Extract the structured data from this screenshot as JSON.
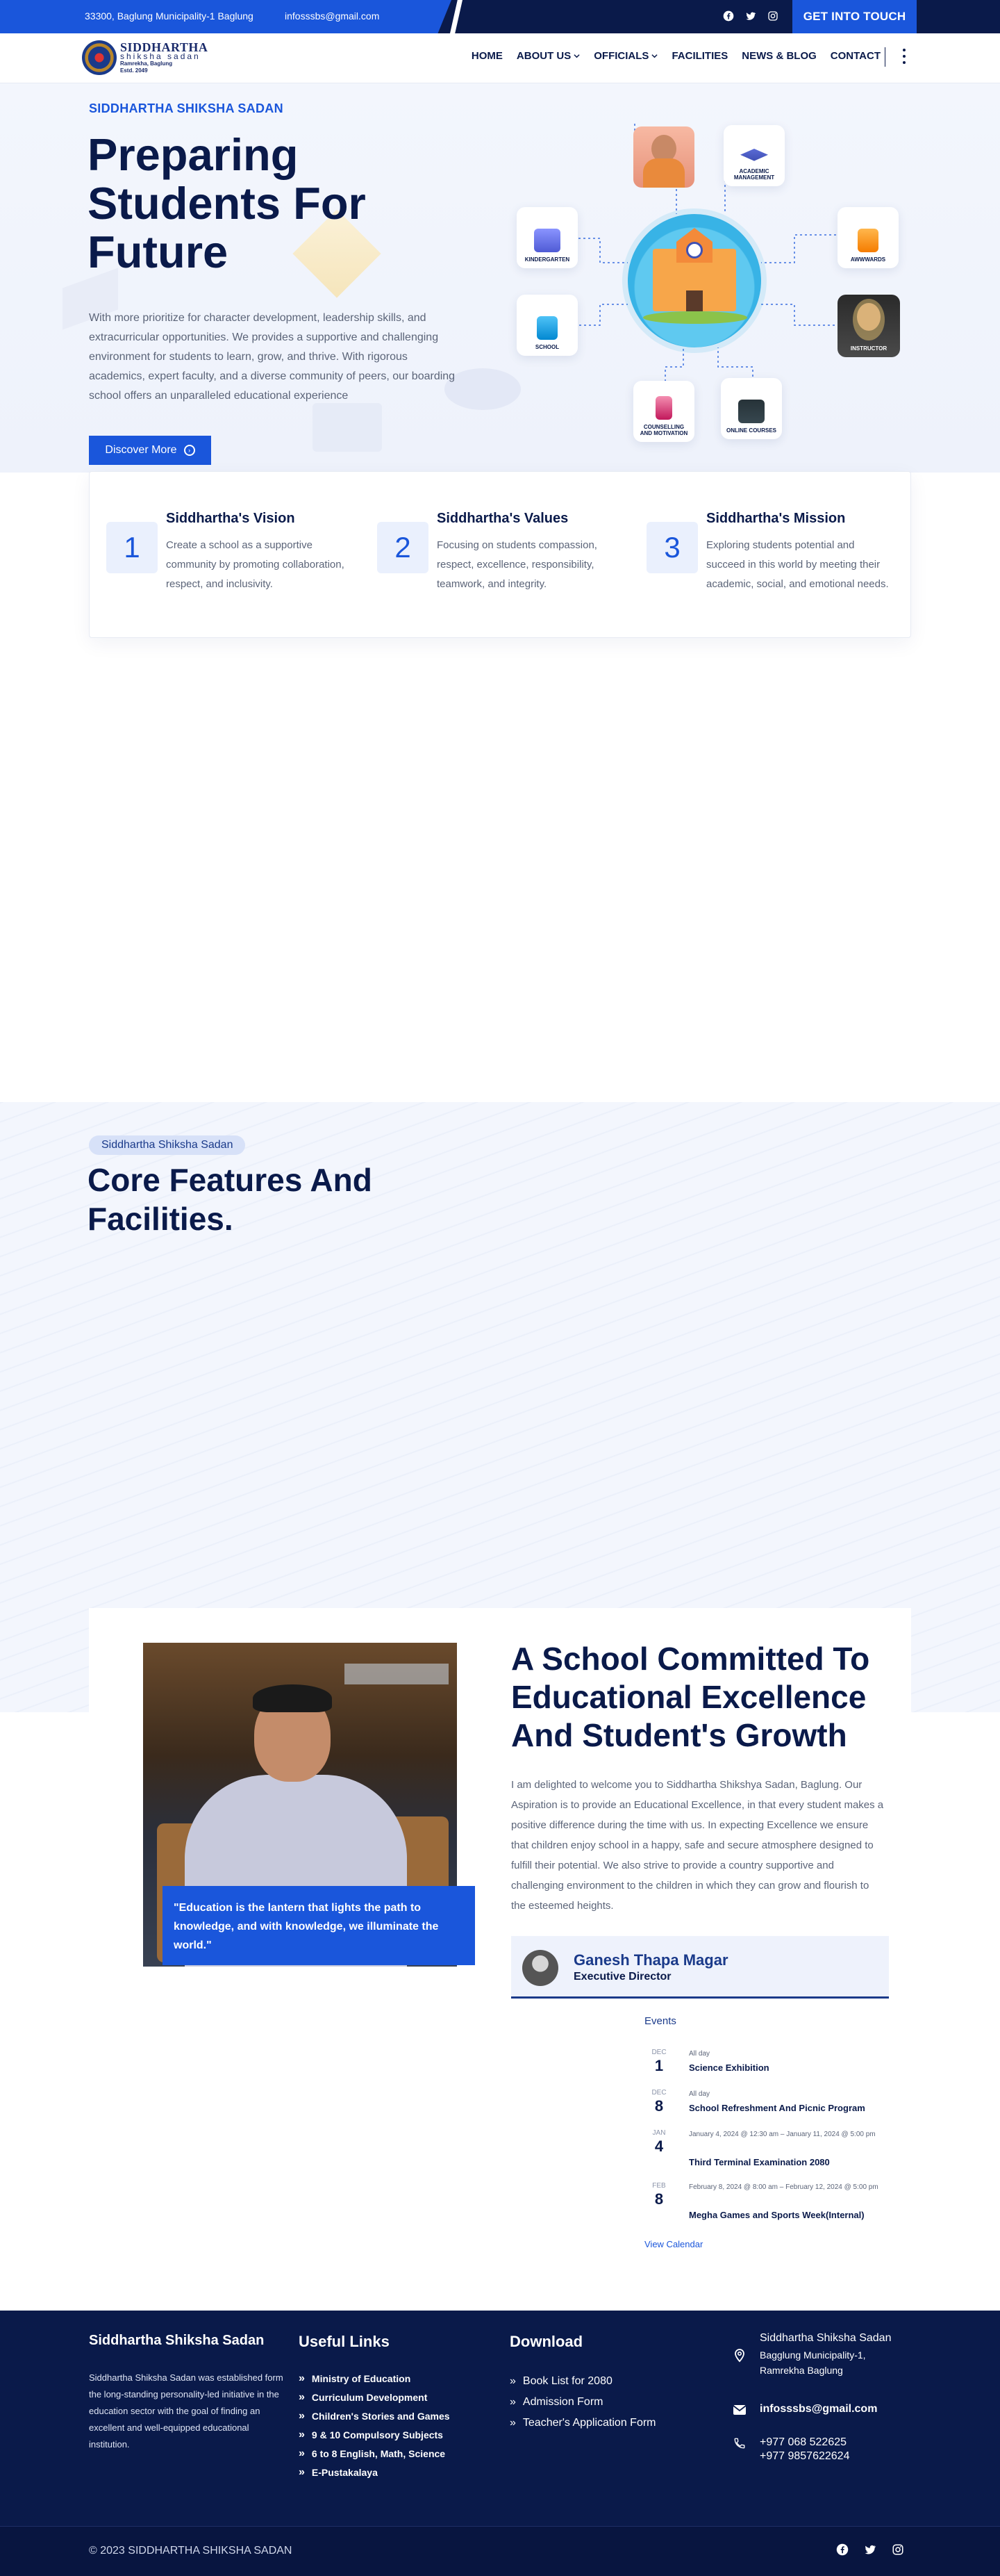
{
  "topbar": {
    "address": "33300, Baglung Municipality-1 Baglung",
    "email": "infosssbs@gmail.com",
    "cta": "GET INTO TOUCH",
    "social": [
      "facebook-icon",
      "twitter-icon",
      "instagram-icon"
    ]
  },
  "logo": {
    "name": "SIDDHARTHA",
    "sub": "shiksha sadan",
    "location": "Ramrekha, Baglung",
    "estd": "Estd. 2049"
  },
  "nav": {
    "items": [
      "HOME",
      "ABOUT US",
      "OFFICIALS",
      "FACILITIES",
      "NEWS & BLOG",
      "CONTACT"
    ]
  },
  "hero": {
    "eyebrow": "SIDDHARTHA SHIKSHA SADAN",
    "title": "Preparing Students For Future",
    "text": "With more prioritize for character development, leadership skills, and extracurricular opportunities. We provides a supportive and challenging environment for students to learn, grow, and thrive. With rigorous academics, expert faculty, and a diverse community of peers, our boarding school offers an unparalleled educational experience",
    "button": "Discover More",
    "illustration": {
      "academic": "ACADEMIC MANAGEMENT",
      "kindergarten": "KINDERGARTEN",
      "awwwards": "AWWWARDS",
      "school": "SCHOOL",
      "instructor": "INSTRUCTOR",
      "counselling": "COUNSELLING AND MOTIVATION",
      "online": "ONLINE COURSES"
    }
  },
  "cards": [
    {
      "num": "1",
      "title": "Siddhartha's Vision",
      "text": "Create a school as a supportive community by promoting collaboration, respect, and inclusivity."
    },
    {
      "num": "2",
      "title": "Siddhartha's Values",
      "text": "Focusing on students compassion, respect, excellence, responsibility, teamwork, and integrity."
    },
    {
      "num": "3",
      "title": "Siddhartha's Mission",
      "text": "Exploring students potential and succeed in this world by meeting their academic, social, and emotional needs."
    }
  ],
  "features": {
    "pill": "Siddhartha Shiksha Sadan",
    "title": "Core Features And Facilities."
  },
  "about": {
    "quote": "\"Education is the lantern that lights the path to knowledge, and with knowledge, we illuminate the world.\"",
    "title": "A School Committed To Educational Excellence And Student's Growth",
    "text": "I am delighted to welcome you to Siddhartha Shikshya Sadan, Baglung. Our Aspiration is to provide an Educational Excellence, in that every student makes a positive difference during the time with us. In expecting Excellence we ensure that children enjoy school in a happy, safe and secure atmosphere designed to fulfill their potential. We also strive to provide a country supportive and challenging environment to the children in which they can grow and flourish to the esteemed heights.",
    "author_name": "Ganesh Thapa Magar",
    "author_role": "Executive Director"
  },
  "events": {
    "title": "Events",
    "items": [
      {
        "month": "DEC",
        "day": "1",
        "time": "All day",
        "name": "Science Exhibition"
      },
      {
        "month": "DEC",
        "day": "8",
        "time": "All day",
        "name": "School Refreshment And Picnic Program"
      },
      {
        "month": "JAN",
        "day": "4",
        "time": "January 4, 2024 @ 12:30 am – January 11, 2024 @ 5:00 pm",
        "name": "Third Terminal Examination 2080"
      },
      {
        "month": "FEB",
        "day": "8",
        "time": "February 8, 2024 @ 8:00 am – February 12, 2024 @ 5:00 pm",
        "name": "Megha Games and Sports Week(Internal)"
      }
    ],
    "view_calendar": "View Calendar"
  },
  "footer": {
    "about_title": "Siddhartha Shiksha Sadan",
    "about_text": "Siddhartha Shiksha Sadan was established form the long-standing personality-led initiative in the education sector with the goal of finding an excellent and well-equipped educational institution.",
    "links_title": "Useful Links",
    "links": [
      "Ministry of Education",
      "Curriculum Development",
      "Children's Stories and Games",
      "9 & 10 Compulsory Subjects",
      "6 to 8 English, Math, Science",
      "E-Pustakalaya"
    ],
    "download_title": "Download",
    "downloads": [
      "Book List for 2080",
      "Admission Form",
      "Teacher's Application Form"
    ],
    "contact": {
      "name": "Siddhartha Shiksha Sadan",
      "address": "Bagglung Municipality-1, Ramrekha Baglung",
      "email": "infosssbs@gmail.com",
      "phone1": "+977 068 522625",
      "phone2": "+977 9857622624"
    },
    "copyright": "© 2023 SIDDHARTHA SHIKSHA SADAN"
  },
  "colors": {
    "brand_blue": "#1a56db",
    "navy": "#0a1a4a"
  }
}
